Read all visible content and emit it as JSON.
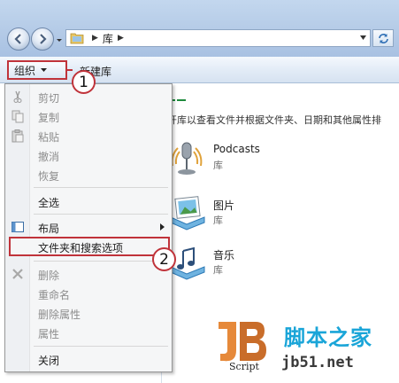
{
  "address": {
    "breadcrumb": "库"
  },
  "toolbar": {
    "organize_label": "组织",
    "new_library_label": "新建库"
  },
  "content": {
    "hint": "开库以查看文件并根据文件夹、日期和其他属性排",
    "libraries": [
      {
        "name": "Podcasts",
        "type": "库",
        "icon": "podcasts-icon"
      },
      {
        "name": "图片",
        "type": "库",
        "icon": "pictures-icon"
      },
      {
        "name": "音乐",
        "type": "库",
        "icon": "music-icon"
      }
    ]
  },
  "menu": {
    "items": [
      {
        "label": "剪切",
        "enabled": false,
        "icon": "cut-icon"
      },
      {
        "label": "复制",
        "enabled": false,
        "icon": "copy-icon"
      },
      {
        "label": "粘贴",
        "enabled": false,
        "icon": "paste-icon"
      },
      {
        "label": "撤消",
        "enabled": false
      },
      {
        "label": "恢复",
        "enabled": false
      },
      {
        "label": "全选",
        "enabled": true
      },
      {
        "label": "布局",
        "enabled": true,
        "icon": "layout-icon",
        "submenu": true
      },
      {
        "label": "文件夹和搜索选项",
        "enabled": true,
        "highlighted": true
      },
      {
        "label": "删除",
        "enabled": false,
        "icon": "delete-icon"
      },
      {
        "label": "重命名",
        "enabled": false
      },
      {
        "label": "删除属性",
        "enabled": false
      },
      {
        "label": "属性",
        "enabled": false
      },
      {
        "label": "关闭",
        "enabled": true
      }
    ]
  },
  "callouts": {
    "one": "1",
    "two": "2"
  },
  "watermark": {
    "logo_text": "Script",
    "site_name": "脚本之家",
    "url": "jb51.net"
  },
  "colors": {
    "annotation_red": "#c0333a",
    "watermark_blue": "#1aa5d8"
  }
}
